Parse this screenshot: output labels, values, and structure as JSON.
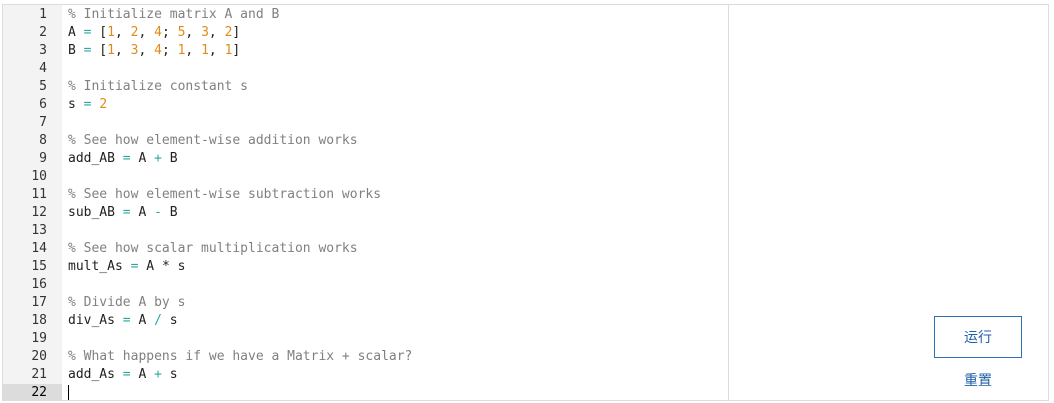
{
  "editor": {
    "lines": [
      {
        "n": "1",
        "tokens": [
          {
            "t": "cmt",
            "v": "% Initialize matrix A and B"
          }
        ]
      },
      {
        "n": "2",
        "tokens": [
          {
            "t": "txt",
            "v": "A "
          },
          {
            "t": "op",
            "v": "="
          },
          {
            "t": "txt",
            "v": " ["
          },
          {
            "t": "num-lit",
            "v": "1"
          },
          {
            "t": "txt",
            "v": ", "
          },
          {
            "t": "num-lit",
            "v": "2"
          },
          {
            "t": "txt",
            "v": ", "
          },
          {
            "t": "num-lit",
            "v": "4"
          },
          {
            "t": "txt",
            "v": "; "
          },
          {
            "t": "num-lit",
            "v": "5"
          },
          {
            "t": "txt",
            "v": ", "
          },
          {
            "t": "num-lit",
            "v": "3"
          },
          {
            "t": "txt",
            "v": ", "
          },
          {
            "t": "num-lit",
            "v": "2"
          },
          {
            "t": "txt",
            "v": "]"
          }
        ]
      },
      {
        "n": "3",
        "tokens": [
          {
            "t": "txt",
            "v": "B "
          },
          {
            "t": "op",
            "v": "="
          },
          {
            "t": "txt",
            "v": " ["
          },
          {
            "t": "num-lit",
            "v": "1"
          },
          {
            "t": "txt",
            "v": ", "
          },
          {
            "t": "num-lit",
            "v": "3"
          },
          {
            "t": "txt",
            "v": ", "
          },
          {
            "t": "num-lit",
            "v": "4"
          },
          {
            "t": "txt",
            "v": "; "
          },
          {
            "t": "num-lit",
            "v": "1"
          },
          {
            "t": "txt",
            "v": ", "
          },
          {
            "t": "num-lit",
            "v": "1"
          },
          {
            "t": "txt",
            "v": ", "
          },
          {
            "t": "num-lit",
            "v": "1"
          },
          {
            "t": "txt",
            "v": "]"
          }
        ]
      },
      {
        "n": "4",
        "tokens": []
      },
      {
        "n": "5",
        "tokens": [
          {
            "t": "cmt",
            "v": "% Initialize constant s"
          }
        ]
      },
      {
        "n": "6",
        "tokens": [
          {
            "t": "txt",
            "v": "s "
          },
          {
            "t": "op",
            "v": "="
          },
          {
            "t": "txt",
            "v": " "
          },
          {
            "t": "num-lit",
            "v": "2"
          }
        ]
      },
      {
        "n": "7",
        "tokens": []
      },
      {
        "n": "8",
        "tokens": [
          {
            "t": "cmt",
            "v": "% See how element-wise addition works"
          }
        ]
      },
      {
        "n": "9",
        "tokens": [
          {
            "t": "txt",
            "v": "add_AB "
          },
          {
            "t": "op",
            "v": "="
          },
          {
            "t": "txt",
            "v": " A "
          },
          {
            "t": "op",
            "v": "+"
          },
          {
            "t": "txt",
            "v": " B"
          }
        ]
      },
      {
        "n": "10",
        "tokens": []
      },
      {
        "n": "11",
        "tokens": [
          {
            "t": "cmt",
            "v": "% See how element-wise subtraction works"
          }
        ]
      },
      {
        "n": "12",
        "tokens": [
          {
            "t": "txt",
            "v": "sub_AB "
          },
          {
            "t": "op",
            "v": "="
          },
          {
            "t": "txt",
            "v": " A "
          },
          {
            "t": "op",
            "v": "-"
          },
          {
            "t": "txt",
            "v": " B"
          }
        ]
      },
      {
        "n": "13",
        "tokens": []
      },
      {
        "n": "14",
        "tokens": [
          {
            "t": "cmt",
            "v": "% See how scalar multiplication works"
          }
        ]
      },
      {
        "n": "15",
        "tokens": [
          {
            "t": "txt",
            "v": "mult_As "
          },
          {
            "t": "op",
            "v": "="
          },
          {
            "t": "txt",
            "v": " A "
          },
          {
            "t": "txt",
            "v": "*"
          },
          {
            "t": "txt",
            "v": " s"
          }
        ]
      },
      {
        "n": "16",
        "tokens": []
      },
      {
        "n": "17",
        "tokens": [
          {
            "t": "cmt",
            "v": "% Divide A by s"
          }
        ]
      },
      {
        "n": "18",
        "tokens": [
          {
            "t": "txt",
            "v": "div_As "
          },
          {
            "t": "op",
            "v": "="
          },
          {
            "t": "txt",
            "v": " A "
          },
          {
            "t": "op",
            "v": "/"
          },
          {
            "t": "txt",
            "v": " s"
          }
        ]
      },
      {
        "n": "19",
        "tokens": []
      },
      {
        "n": "20",
        "tokens": [
          {
            "t": "cmt",
            "v": "% What happens if we have a Matrix + scalar?"
          }
        ]
      },
      {
        "n": "21",
        "tokens": [
          {
            "t": "txt",
            "v": "add_As "
          },
          {
            "t": "op",
            "v": "="
          },
          {
            "t": "txt",
            "v": " A "
          },
          {
            "t": "op",
            "v": "+"
          },
          {
            "t": "txt",
            "v": " s"
          }
        ]
      },
      {
        "n": "22",
        "tokens": [],
        "active": true
      }
    ]
  },
  "controls": {
    "run_label": "运行",
    "reset_label": "重置"
  },
  "colors": {
    "comment": "#808080",
    "number": "#e08a1b",
    "operator": "#2aa8a0",
    "button_border": "#2f6fb5",
    "link": "#1f5fa8"
  }
}
